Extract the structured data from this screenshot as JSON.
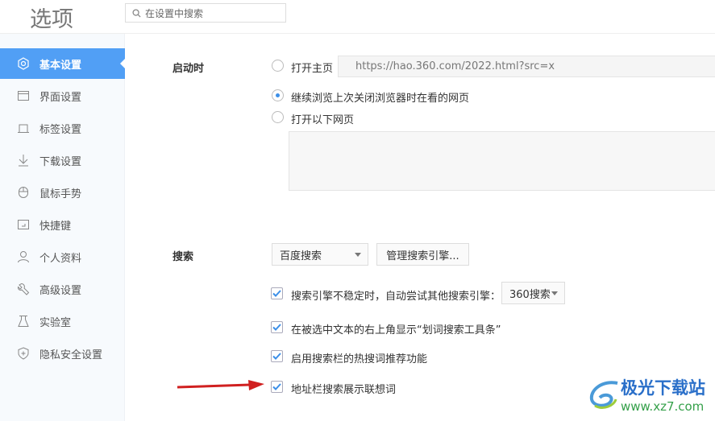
{
  "header": {
    "title": "选项",
    "search_placeholder": "在设置中搜索"
  },
  "sidebar": {
    "items": [
      {
        "label": "基本设置",
        "icon": "settings-icon",
        "active": true
      },
      {
        "label": "界面设置",
        "icon": "window-icon"
      },
      {
        "label": "标签设置",
        "icon": "tab-icon"
      },
      {
        "label": "下载设置",
        "icon": "download-icon"
      },
      {
        "label": "鼠标手势",
        "icon": "mouse-icon"
      },
      {
        "label": "快捷键",
        "icon": "keyboard-icon"
      },
      {
        "label": "个人资料",
        "icon": "user-icon"
      },
      {
        "label": "高级设置",
        "icon": "wrench-icon"
      },
      {
        "label": "实验室",
        "icon": "flask-icon"
      },
      {
        "label": "隐私安全设置",
        "icon": "shield-icon"
      }
    ]
  },
  "startup": {
    "label": "启动时",
    "open_home": "打开主页",
    "home_url": "https://hao.360.com/2022.html?src=x",
    "continue": "继续浏览上次关闭浏览器时在看的网页",
    "open_pages": "打开以下网页",
    "selected": "continue"
  },
  "search": {
    "label": "搜索",
    "engine": "百度搜索",
    "manage": "管理搜索引擎...",
    "options": [
      {
        "text": "搜索引擎不稳定时，自动尝试其他搜索引擎：",
        "checked": true
      },
      {
        "text": "在被选中文本的右上角显示“划词搜索工具条”",
        "checked": true
      },
      {
        "text": "启用搜索栏的热搜词推荐功能",
        "checked": true
      },
      {
        "text": "地址栏搜索展示联想词",
        "checked": true
      }
    ],
    "fallback_engine": "360搜索"
  },
  "watermark": {
    "name": "极光下载站",
    "url": "www.xz7.com"
  },
  "colors": {
    "accent": "#519ff5",
    "arrow": "#d02020"
  }
}
